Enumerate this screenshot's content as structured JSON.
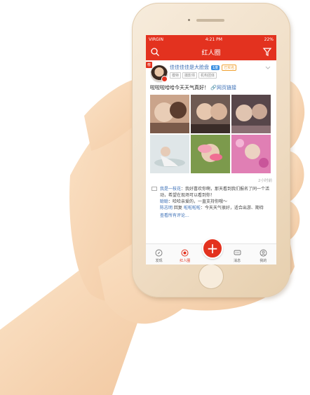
{
  "status": {
    "carrier": "VIRGIN",
    "time": "4:21 PM",
    "battery": "22%"
  },
  "nav": {
    "title": "红人圈"
  },
  "post": {
    "hot_tag": "荐",
    "username": "佳佳佳佳是大脸盘",
    "level": "1度",
    "verified": "已实名",
    "tags": [
      "模特",
      "摄影师",
      "机构团体"
    ],
    "text": "啦啦啦哈哈今天天气真好！",
    "link": "网页链接",
    "time": "2小时前"
  },
  "comments": [
    {
      "name": "我是一枝花",
      "text": "：我好喜欢你啊，那天看到我们报名了同一个活动，希望在现场可以看到你！"
    },
    {
      "name": "聪聪",
      "text": "：哈哈亲爱的，一直支持你哦～"
    },
    {
      "name": "陈志明",
      "reply_word": " 回复 ",
      "reply_to": "啦啦啦啦",
      "text": "：今天天气很好，适合出游、期待"
    }
  ],
  "more_comments": "查看所有评论...",
  "tabs": [
    {
      "label": "发现",
      "icon": "compass-icon"
    },
    {
      "label": "红人圈",
      "icon": "target-icon"
    },
    {
      "label": "消息",
      "icon": "chat-icon"
    },
    {
      "label": "我的",
      "icon": "profile-icon"
    }
  ],
  "colors": {
    "brand": "#e3321f",
    "link": "#3b6fb6"
  }
}
